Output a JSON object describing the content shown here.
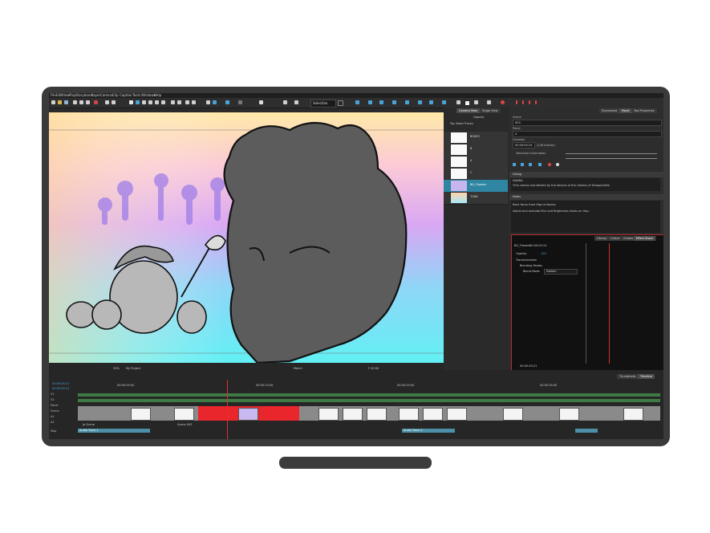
{
  "menu": [
    "File",
    "Edit",
    "View",
    "Play",
    "Storyboard",
    "Layer",
    "Camera",
    "Clip",
    "Caption",
    "Tools",
    "Windows",
    "Help"
  ],
  "toolbar": {
    "zoom_field": "Selection",
    "opacity_field": "100"
  },
  "stage": {
    "zoom": "30%",
    "view_label": "My Project",
    "center_label": "Match",
    "frame_label": "F 00:00"
  },
  "layers_panel": {
    "tabs": [
      "Camera View",
      "Stage View"
    ],
    "header": "Toy Video Tracks",
    "opacity_label": "Opacity",
    "layers": [
      {
        "name": "BOXES",
        "selected": false
      },
      {
        "name": "B",
        "selected": false
      },
      {
        "name": "A",
        "selected": false
      },
      {
        "name": "C",
        "selected": false
      },
      {
        "name": "BG_Flowers",
        "selected": true
      },
      {
        "name": "TONE",
        "selected": false
      }
    ]
  },
  "right_panel": {
    "tabs": [
      "Storyboard",
      "Panel",
      "Tool Properties"
    ],
    "active_tab": "Panel",
    "scene_label": "Scene",
    "scene_value": "003",
    "panel_label": "Panel",
    "panel_value": "4",
    "duration_label": "Duration",
    "duration_value": "00:00:05:15",
    "duration_frames": "(136 frames)",
    "selection_info_label": "Selection Information",
    "dialog_header": "Dialog",
    "dialog_speaker": "NANNA",
    "dialog_text": "Y/Ou seems manifested by the desires of the citizens of Drooplevillle.",
    "notes_header": "Notes",
    "notes_line1": "Rack focus from Hap to Nanna.",
    "notes_line2": "Adjust and animate Blur and Brightness levels on Hap."
  },
  "effect_panel": {
    "tabs": [
      "Library",
      "Colour",
      "Guides",
      "Effect Stack"
    ],
    "active_tab": "Effect Stack",
    "layer_name": "BG_Flowers",
    "time_code": "00:00:05:15",
    "opacity_label": "Opacity",
    "opacity_value": "100",
    "transformation_label": "Transformation",
    "blending_label": "Blending Modes",
    "blend_mode_label": "Blend Mode",
    "blend_mode_value": "Darken",
    "footer_code": "00:00:45:21"
  },
  "timeline": {
    "tabs": [
      "Thumbnails",
      "Timeline"
    ],
    "active_tab": "Timeline",
    "timecode": "00:00:45:21",
    "sub_timecode": "00:00:45:21",
    "ruler": [
      "00:00:05:00",
      "00:00:15:00",
      "00:00:25:00",
      "00:00:35:00"
    ],
    "tracks": [
      "V1",
      "V2",
      "Panel",
      "Scene",
      "A1",
      "A2",
      "Map"
    ],
    "track_labels": [
      "Jo Scene",
      "Scene 003"
    ],
    "audio_clips": [
      "Audio Track 1",
      "Audio Track 2"
    ]
  },
  "colors": {
    "accent": "#2e86a3",
    "selection_red": "#e8262b",
    "panel_bg": "#2a2a2a",
    "monitor": "#3a3a3a"
  }
}
